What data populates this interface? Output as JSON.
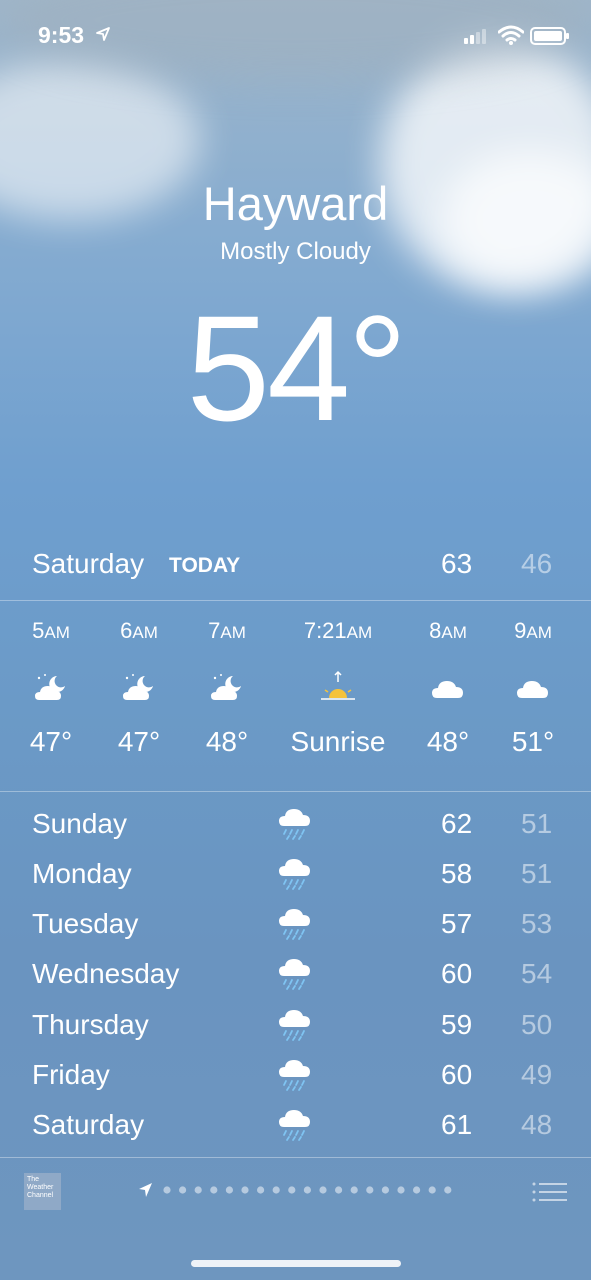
{
  "status_bar": {
    "time": "9:53"
  },
  "header": {
    "city": "Hayward",
    "condition": "Mostly Cloudy",
    "temperature": "54°"
  },
  "today": {
    "day": "Saturday",
    "label": "TODAY",
    "high": "63",
    "low": "46"
  },
  "hourly": [
    {
      "time": "5",
      "suffix": "AM",
      "icon": "partly-cloudy-night-icon",
      "value": "47°"
    },
    {
      "time": "6",
      "suffix": "AM",
      "icon": "partly-cloudy-night-icon",
      "value": "47°"
    },
    {
      "time": "7",
      "suffix": "AM",
      "icon": "partly-cloudy-night-icon",
      "value": "48°"
    },
    {
      "time": "7:21",
      "suffix": "AM",
      "icon": "sunrise-icon",
      "value": "Sunrise"
    },
    {
      "time": "8",
      "suffix": "AM",
      "icon": "cloud-icon",
      "value": "48°"
    },
    {
      "time": "9",
      "suffix": "AM",
      "icon": "cloud-icon",
      "value": "51°"
    }
  ],
  "daily": [
    {
      "day": "Sunday",
      "icon": "rain-cloud-icon",
      "high": "62",
      "low": "51"
    },
    {
      "day": "Monday",
      "icon": "rain-cloud-icon",
      "high": "58",
      "low": "51"
    },
    {
      "day": "Tuesday",
      "icon": "rain-cloud-icon",
      "high": "57",
      "low": "53"
    },
    {
      "day": "Wednesday",
      "icon": "rain-cloud-icon",
      "high": "60",
      "low": "54"
    },
    {
      "day": "Thursday",
      "icon": "rain-cloud-icon",
      "high": "59",
      "low": "50"
    },
    {
      "day": "Friday",
      "icon": "rain-cloud-icon",
      "high": "60",
      "low": "49"
    },
    {
      "day": "Saturday",
      "icon": "rain-cloud-icon",
      "high": "61",
      "low": "48"
    }
  ],
  "footer": {
    "logo_text": "The Weather Channel",
    "page_count": 19,
    "current_page": 0
  },
  "colors": {
    "secondary_text": "#ffffff80",
    "divider": "#ffffff59"
  }
}
